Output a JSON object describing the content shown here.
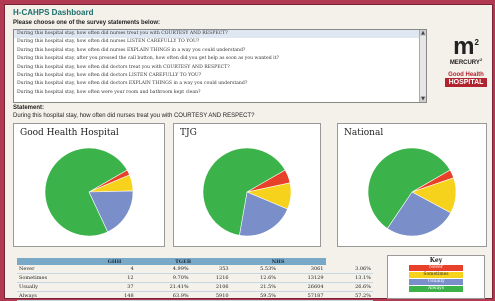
{
  "title": "H-CAHPS Dashboard",
  "prompt": "Please choose one of the survey statements below:",
  "statements": [
    "During this hospital stay, how often did nurses treat you with COURTESY AND RESPECT?",
    "During this hospital stay, how often did nurses LISTEN CAREFULLY TO YOU?",
    "During this hospital stay, how often did nurses EXPLAIN THINGS in a way you could understand?",
    "During this hospital stay, after you pressed the call button, how often did you get help as soon as you wanted it?",
    "During this hospital stay, how often did doctors treat you with COURTESY AND RESPECT?",
    "During this hospital stay, how often did doctors LISTEN CAREFULLY TO YOU?",
    "During this hospital stay, how often did doctors EXPLAIN THINGS in a way you could understand?",
    "During this hospital stay, how often were your room and bathroom kept clean?"
  ],
  "selected_index": 0,
  "logo": {
    "mark": "m",
    "sup": "2",
    "brand": "MERCURY",
    "brand_sup": "2",
    "hospital_line1": "Good Health",
    "hospital_line2": "HOSPITAL"
  },
  "statement_label": "Statement:",
  "statement_text": "During this hospital stay, how often did nurses treat you with COURTESY AND RESPECT?",
  "panels": [
    {
      "name": "Good Health Hospital",
      "slices": [
        4,
        12,
        37,
        148
      ]
    },
    {
      "name": "TJG",
      "slices": [
        4.99,
        9.7,
        21.4,
        63.9
      ]
    },
    {
      "name": "National",
      "slices": [
        3.1,
        13.1,
        26.6,
        57.2
      ]
    }
  ],
  "colors": {
    "never": "#e8412a",
    "sometimes": "#f7d21c",
    "usually": "#7a8fc9",
    "always": "#3bb34a",
    "accent": "#b13a52"
  },
  "table": {
    "headers": [
      "",
      "GHH",
      "TGEB",
      "",
      "NHS",
      ""
    ],
    "rows": [
      [
        "Never",
        "4",
        "4.99%",
        "353",
        "5.53%",
        "3061",
        "3.06%"
      ],
      [
        "Sometimes",
        "12",
        "9.70%",
        "1216",
        "12.6%",
        "13129",
        "13.1%"
      ],
      [
        "Usually",
        "37",
        "21.41%",
        "2106",
        "21.5%",
        "26604",
        "26.6%"
      ],
      [
        "Always",
        "148",
        "63.9%",
        "5910",
        "59.5%",
        "57187",
        "57.2%"
      ]
    ]
  },
  "key": {
    "title": "Key",
    "items": [
      "Never",
      "Sometimes",
      "Usually",
      "Always"
    ]
  }
}
